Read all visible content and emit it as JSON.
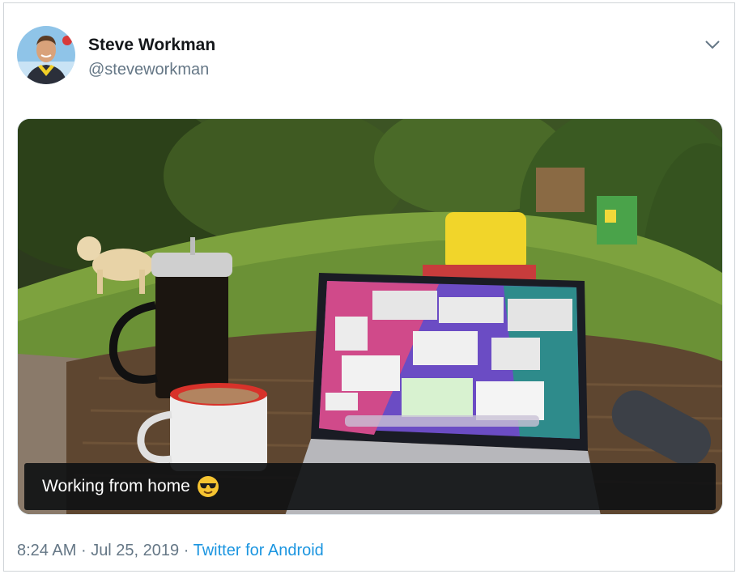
{
  "tweet": {
    "author_name": "Steve Workman",
    "author_handle": "@steveworkman",
    "photo_caption": "Working from home",
    "time": "8:24 AM",
    "separator": "·",
    "date": "Jul 25, 2019",
    "source": "Twitter for Android"
  },
  "icons": {
    "menu": "chevron-down-icon",
    "emoji": "smiling-face-with-sunglasses"
  },
  "colors": {
    "link": "#1b95e0",
    "secondary_text": "#657786",
    "primary_text": "#14171a"
  }
}
